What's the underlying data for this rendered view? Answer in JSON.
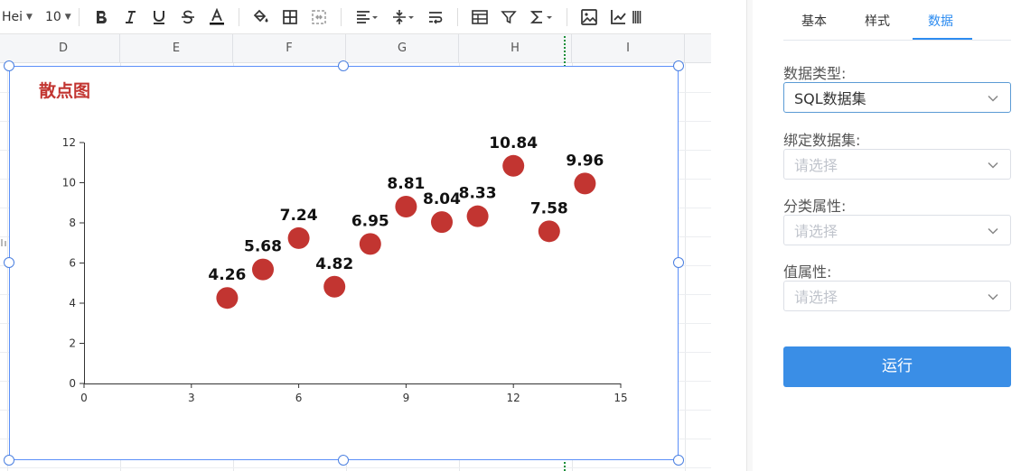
{
  "toolbar": {
    "font_name": "Hei",
    "font_size": "10"
  },
  "columns": [
    "D",
    "E",
    "F",
    "G",
    "H",
    "I"
  ],
  "chart": {
    "title": "散点图"
  },
  "chart_data": {
    "type": "scatter",
    "title": "散点图",
    "xlabel": "",
    "ylabel": "",
    "xlim": [
      0,
      15
    ],
    "ylim": [
      0,
      12
    ],
    "x_ticks": [
      0,
      3,
      6,
      9,
      12,
      15
    ],
    "y_ticks": [
      0,
      2,
      4,
      6,
      8,
      10,
      12
    ],
    "grid": false,
    "series": [
      {
        "x": [
          4,
          5,
          6,
          7,
          8,
          9,
          10,
          11,
          12,
          13,
          14
        ],
        "y": [
          4.26,
          5.68,
          7.24,
          4.82,
          6.95,
          8.81,
          8.04,
          8.33,
          10.84,
          7.58,
          9.96
        ],
        "labels": [
          "4.26",
          "5.68",
          "7.24",
          "4.82",
          "6.95",
          "8.81",
          "8.04",
          "8.33",
          "10.84",
          "7.58",
          "9.96"
        ],
        "color": "#c23531"
      }
    ]
  },
  "panel": {
    "tabs": [
      {
        "label": "基本"
      },
      {
        "label": "样式"
      },
      {
        "label": "数据"
      }
    ],
    "active_tab": "数据",
    "data_type_label": "数据类型:",
    "data_type_value": "SQL数据集",
    "bind_dataset_label": "绑定数据集:",
    "bind_dataset_placeholder": "请选择",
    "category_attr_label": "分类属性:",
    "category_attr_placeholder": "请选择",
    "value_attr_label": "值属性:",
    "value_attr_placeholder": "请选择",
    "run_button": "运行"
  },
  "colors": {
    "accent": "#2d8cf0",
    "primary_button": "#3a8ee6",
    "series": "#c23531",
    "freeze_line": "#1b8f3a"
  }
}
